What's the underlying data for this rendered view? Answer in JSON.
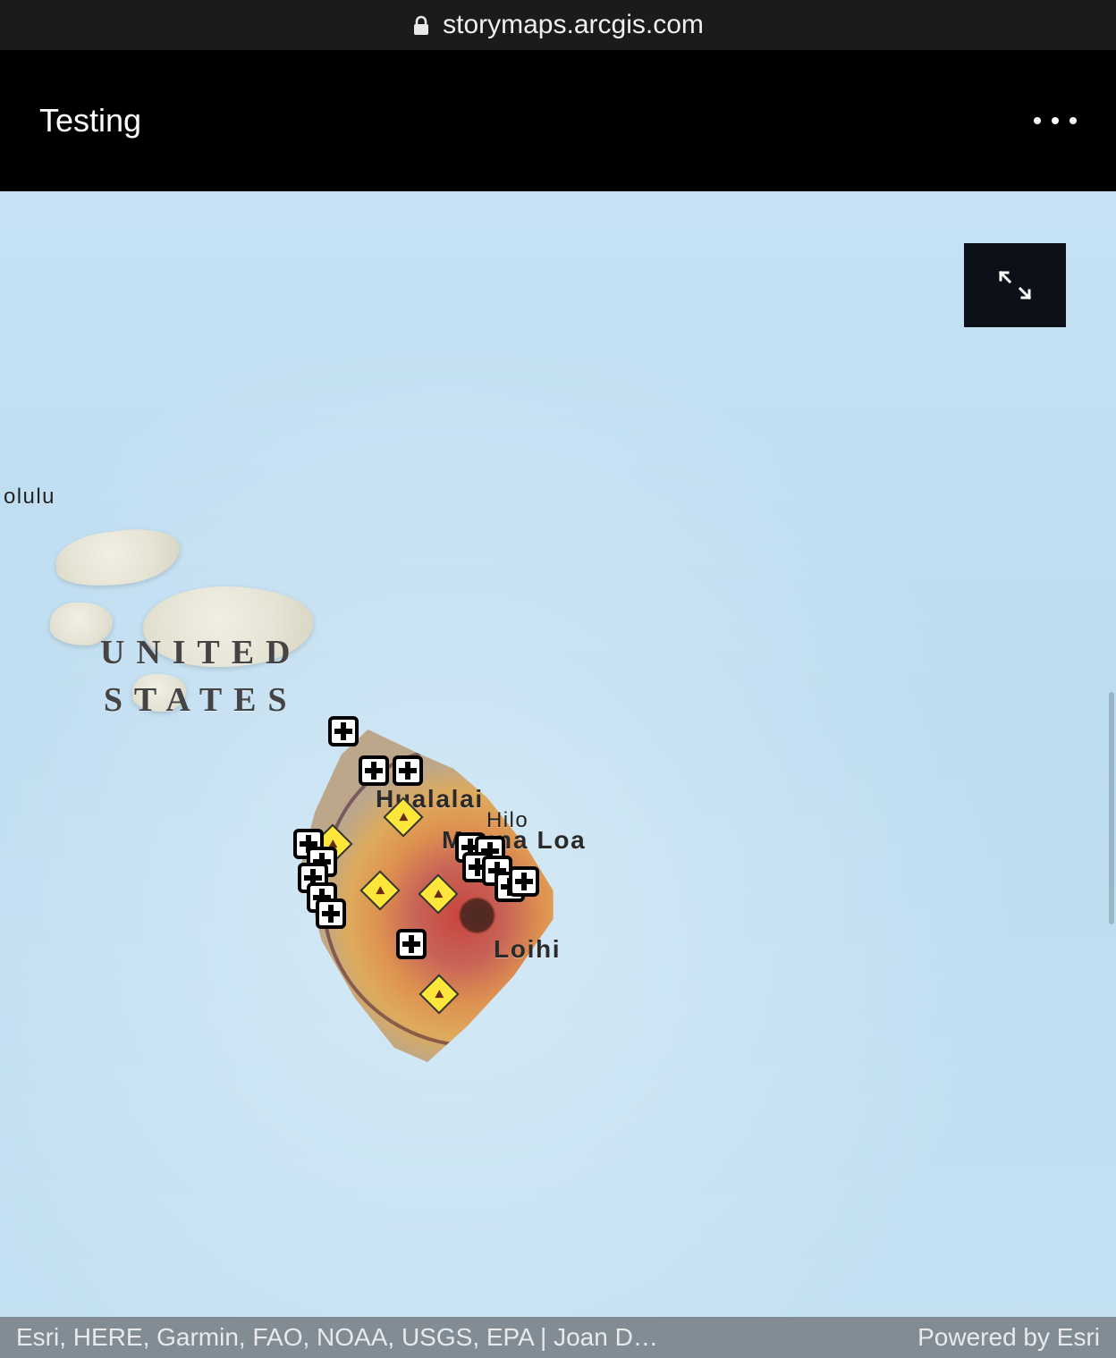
{
  "browser": {
    "url_display": "storymaps.arcgis.com"
  },
  "header": {
    "title": "Testing"
  },
  "map": {
    "labels": {
      "country": "UNITED STATES",
      "city_fragment": "olulu",
      "feature_hualalai": "Hualalai",
      "feature_maunaloa": "Mauna Loa",
      "feature_loihi": "Loihi",
      "city_hilo": "Hilo"
    }
  },
  "attribution": {
    "sources": "Esri, HERE, Garmin, FAO, NOAA, USGS, EPA | Joan D…",
    "powered_by": "Powered by Esri"
  }
}
